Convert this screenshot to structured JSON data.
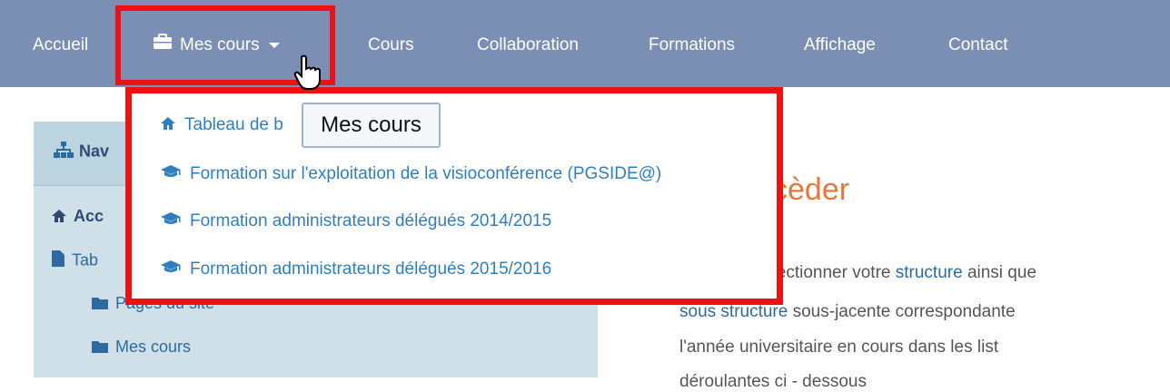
{
  "nav": {
    "items": [
      "Accueil",
      "Mes cours",
      "Cours",
      "Collaboration",
      "Formations",
      "Affichage",
      "Contact"
    ]
  },
  "dropdown": {
    "items": [
      "Tableau de b",
      "Formation sur l'exploitation de la visioconférence (PGSIDE@)",
      "Formation administrateurs délégués 2014/2015",
      "Formation administrateurs délégués 2015/2016"
    ]
  },
  "tooltip": {
    "text": "Mes cours"
  },
  "navigation_block": {
    "title": "Nav",
    "items": [
      "Acc",
      "Tab",
      "Pages du site",
      "Mes cours"
    ]
  },
  "content": {
    "heading": "cèder",
    "para1_pre": "électionner votre ",
    "para1_link": "structure",
    "para1_post": " ainsi que",
    "para2_link": "sous structure",
    "para2_post": " sous-jacente correspondante",
    "para3": "l'année universitaire en cours dans les list",
    "para4": "déroulantes ci - dessous"
  },
  "colors": {
    "navbar": "#7b8fb5",
    "highlight": "#ee1111",
    "link": "#2f7fc0",
    "heading": "#e07a3a"
  },
  "icons": {
    "mes_cours": "briefcase-icon",
    "tableau": "home-icon",
    "formation": "graduation-cap-icon",
    "navigation": "sitemap-icon",
    "page": "file-icon",
    "folder": "folder-icon"
  }
}
